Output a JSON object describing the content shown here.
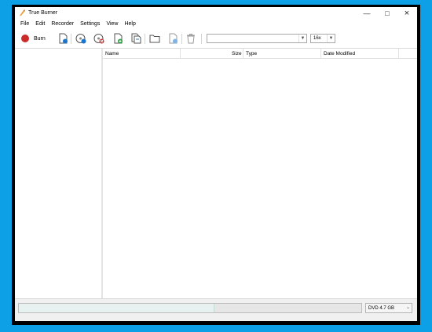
{
  "window": {
    "title": "True Burner"
  },
  "menu": [
    "File",
    "Edit",
    "Recorder",
    "Settings",
    "View",
    "Help"
  ],
  "toolbar": {
    "burn_label": "Burn",
    "drive_select": "",
    "speed_select": "16x"
  },
  "list": {
    "columns": {
      "name": "Name",
      "size": "Size",
      "type": "Type",
      "date": "Date Modified"
    }
  },
  "status": {
    "progress": 0.57,
    "disc_type": "DVD 4.7 GB"
  },
  "colors": {
    "background": "#0ea0e6",
    "burn": "#cc2b2b",
    "accent_blue": "#1e74c9",
    "green": "#2f9e44"
  }
}
